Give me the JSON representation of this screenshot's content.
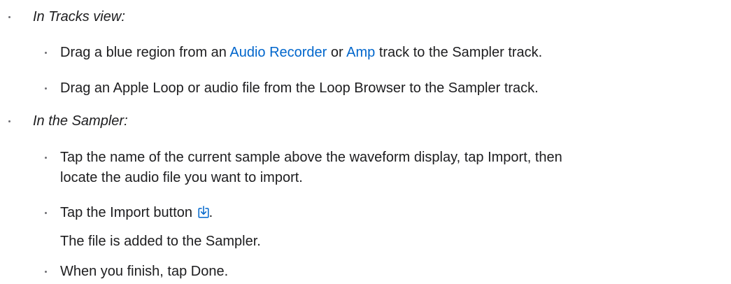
{
  "list": {
    "section1": {
      "heading": "In Tracks view:",
      "item1": {
        "before": "Drag a blue region from an ",
        "link1": "Audio Recorder",
        "middle": " or ",
        "link2": "Amp",
        "after": " track to the Sampler track."
      },
      "item2": "Drag an Apple Loop or audio file from the Loop Browser to the Sampler track."
    },
    "section2": {
      "heading": "In the Sampler:",
      "item1_line1": "Tap the name of the current sample above the waveform display, tap Import, then",
      "item1_line2": "locate the audio file you want to import.",
      "item2": {
        "before": "Tap the Import button ",
        "after": "."
      },
      "item2_result": "The file is added to the Sampler.",
      "item3": "When you finish, tap Done."
    }
  },
  "icons": {
    "import": "import-icon"
  },
  "colors": {
    "text": "#1d1d1f",
    "link": "#0066cc",
    "bullet": "#6e6e73"
  }
}
